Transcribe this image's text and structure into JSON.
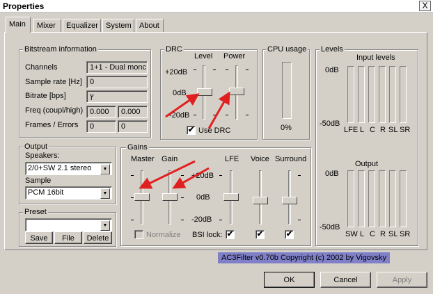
{
  "window": {
    "title": "Properties",
    "close": "X"
  },
  "tabs": [
    "Main",
    "Mixer",
    "Equalizer",
    "System",
    "About"
  ],
  "bitstream": {
    "title": "Bitstream information",
    "channels_label": "Channels",
    "channels_value": "1+1 - Dual monc",
    "samplerate_label": "Sample rate [Hz]",
    "samplerate_value": "0",
    "bitrate_label": "Bitrate [bps]",
    "bitrate_value": "ץ",
    "freq_label": "Freq (coupl/high)",
    "freq_value1": "0.000",
    "freq_value2": "0.000",
    "frames_label": "Frames / Errors",
    "frames_value1": "0",
    "frames_value2": "0"
  },
  "drc": {
    "title": "DRC",
    "level_label": "Level",
    "power_label": "Power",
    "scale_top": "+20dB",
    "scale_mid": "0dB",
    "scale_bottom": "-20dB",
    "use_drc_label": "Use DRC",
    "use_drc_checked": true
  },
  "cpu": {
    "title": "CPU usage",
    "value": "0%"
  },
  "levels": {
    "title": "Levels",
    "input_title": "Input levels",
    "input_top": "0dB",
    "input_bottom": "-50dB",
    "input_channels": [
      "LFE",
      "L",
      "C",
      "R",
      "SL",
      "SR"
    ],
    "output_title": "Output",
    "output_top": "0dB",
    "output_bottom": "-50dB",
    "output_channels": [
      "SW",
      "L",
      "C",
      "R",
      "SL",
      "SR"
    ]
  },
  "output": {
    "title": "Output",
    "speakers_label": "Speakers:",
    "speakers_value": "2/0+SW 2.1 stereo",
    "sample_label": "Sample",
    "sample_value": "PCM 16bit"
  },
  "preset": {
    "title": "Preset",
    "value": "",
    "save": "Save",
    "file": "File",
    "delete": "Delete"
  },
  "gains": {
    "title": "Gains",
    "master_label": "Master",
    "gain_label": "Gain",
    "scale_top": "+20dB",
    "scale_mid": "0dB",
    "scale_bottom": "-20dB",
    "lfe_label": "LFE",
    "voice_label": "Voice",
    "surround_label": "Surround",
    "normalize_label": "Normalize",
    "bsi_lock_label": "BSI lock:"
  },
  "copyright": "AC3Filter v0.70b Copyright (c) 2002 by Vigovsky",
  "buttons": {
    "ok": "OK",
    "cancel": "Cancel",
    "apply": "Apply"
  },
  "annotation_color": "#e02020"
}
